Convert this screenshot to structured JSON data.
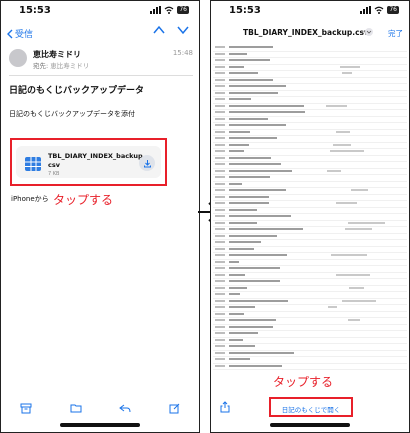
{
  "left_screen": {
    "status_time": "15:53",
    "battery": "76",
    "back_label": "受信",
    "sender_name": "恵比寿ミドリ",
    "to_label": "宛先:",
    "to_value": "恵比寿ミドリ",
    "received_time": "15:48",
    "subject": "日記のもくじバックアップデータ",
    "body": "日記のもくじバックアップデータを添付",
    "attachment_name": "TBL_DIARY_INDEX_backup.csv",
    "attachment_size": "7 KB",
    "signature": "iPhoneから",
    "annotation": "タップする"
  },
  "right_screen": {
    "status_time": "15:53",
    "battery": "76",
    "file_title": "TBL_DIARY_INDEX_backup.csv",
    "done_label": "完了",
    "open_button": "日記のもくじで開く",
    "annotation": "タップする"
  },
  "colors": {
    "accent": "#1a73e8",
    "annotation_red": "#e8202a"
  }
}
